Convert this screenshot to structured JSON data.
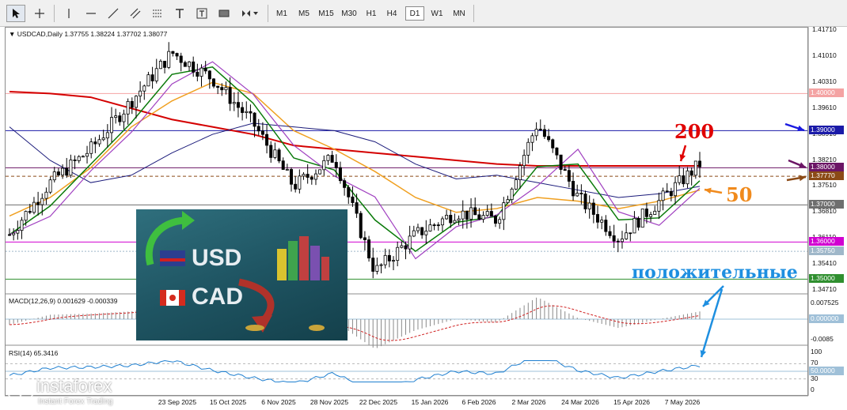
{
  "toolbar": {
    "timeframes": [
      "M1",
      "M5",
      "M15",
      "M30",
      "H1",
      "H4",
      "D1",
      "W1",
      "MN"
    ],
    "active_timeframe": "D1"
  },
  "chart_header": {
    "symbol_info": "USDCAD,Daily",
    "ohlc": "1.37755 1.38224 1.37702 1.38077"
  },
  "macd_header": "MACD(12,26,9) 0.001629 -0.000339",
  "rsi_header": "RSI(14) 65.3416",
  "price_axis": [
    "1.41710",
    "1.41010",
    "1.40310",
    "1.39610",
    "1.38910",
    "1.38210",
    "1.37510",
    "1.36810",
    "1.36110",
    "1.35410",
    "1.34710"
  ],
  "macd_axis": [
    "0.007525",
    "0.000000",
    "-0.0085"
  ],
  "rsi_axis": [
    "100",
    "70",
    "50",
    "30",
    "0"
  ],
  "date_labels": [
    "23 Sep 2025",
    "15 Oct 2025",
    "6 Nov 2025",
    "28 Nov 2025",
    "22 Dec 2025",
    "15 Jan 2026",
    "6 Feb 2026",
    "2 Mar 2026",
    "24 Mar 2026",
    "15 Apr 2026",
    "7 May 2026"
  ],
  "price_tags": [
    {
      "text": "1.40000",
      "color": "#f4a3a3",
      "price": 1.4
    },
    {
      "text": "1.39000",
      "color": "#1a1aa8",
      "price": 1.39
    },
    {
      "text": "1.38000",
      "color": "#6b1565",
      "price": 1.38
    },
    {
      "text": "1.37770",
      "color": "#8b4a16",
      "price": 1.3777
    },
    {
      "text": "1.37000",
      "color": "#6e6e6e",
      "price": 1.37
    },
    {
      "text": "1.36000",
      "color": "#d100d1",
      "price": 1.36
    },
    {
      "text": "1.35750",
      "color": "#9fb7c9",
      "price": 1.3575
    },
    {
      "text": "1.35000",
      "color": "#2f8f2f",
      "price": 1.35
    },
    {
      "text": "0.000000",
      "color": "#9fc0d8",
      "pane": "macd"
    },
    {
      "text": "50.0000",
      "color": "#9fc0d8",
      "pane": "rsi"
    }
  ],
  "annotations": {
    "ma200": "200",
    "ma50": "50",
    "positive": "положительные"
  },
  "picture": {
    "usd": "USD",
    "cad": "CAD"
  },
  "logo": {
    "brand": "instaforex",
    "tagline": "Instant Forex Trading"
  },
  "colors": {
    "bull_candle": "#000000",
    "ma200": "#d40000",
    "ma50": "#f0a020",
    "ma_blue": "#1a1a7a",
    "ma_green": "#0a7a0a",
    "ma_purple": "#a040c0",
    "annotation_red": "#e00000",
    "annotation_orange": "#f08a1c",
    "annotation_blue": "#1e8fe0"
  },
  "chart_data": {
    "type": "line",
    "symbol": "USDCAD",
    "timeframe": "Daily",
    "x": [
      "Sep 2025",
      "Sep 2025",
      "Oct 2025",
      "Oct 2025",
      "Nov 2025",
      "Nov 2025",
      "Dec 2025",
      "Dec 2025",
      "Jan 2026",
      "Jan 2026",
      "Feb 2026",
      "Feb 2026",
      "Mar 2026",
      "Mar 2026",
      "Apr 2026",
      "Apr 2026",
      "May 2026",
      "May 2026"
    ],
    "series": [
      {
        "values": [
          1.362,
          1.376,
          1.385,
          1.398,
          1.411,
          1.404,
          1.392,
          1.375,
          1.383,
          1.352,
          1.362,
          1.368,
          1.366,
          1.392,
          1.372,
          1.361,
          1.371,
          1.381
        ]
      },
      {
        "values": [
          1.4005,
          1.4,
          1.399,
          1.396,
          1.393,
          1.391,
          1.389,
          1.386,
          1.385,
          1.384,
          1.383,
          1.382,
          1.381,
          1.3805,
          1.3805,
          1.3805,
          1.3805,
          1.3805
        ]
      },
      {
        "values": [
          1.367,
          1.372,
          1.38,
          1.391,
          1.398,
          1.403,
          1.4,
          1.39,
          1.385,
          1.379,
          1.372,
          1.368,
          1.369,
          1.372,
          1.371,
          1.369,
          1.371,
          1.374
        ]
      }
    ],
    "levels": [
      1.4,
      1.39,
      1.38,
      1.3777,
      1.37,
      1.36,
      1.3575,
      1.35
    ],
    "ylim": [
      1.3471,
      1.4171
    ]
  }
}
